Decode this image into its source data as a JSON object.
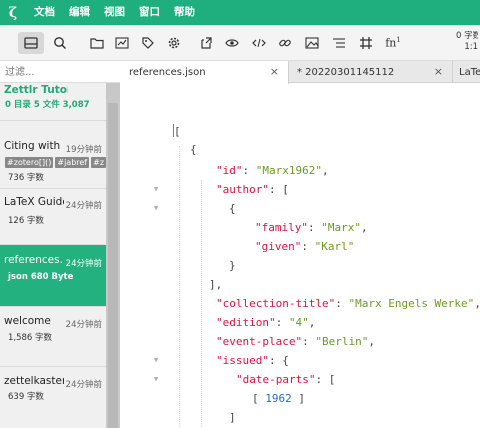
{
  "menubar": {
    "logo_glyph": "ζ",
    "items": [
      "文档",
      "编辑",
      "视图",
      "窗口",
      "帮助"
    ]
  },
  "toolbar": {
    "stats_line1": "0 字数",
    "stats_line2": "1:1"
  },
  "sidebar": {
    "filter_placeholder": "过滤...",
    "files": [
      {
        "title": "Zettlr Tutorial",
        "time": "",
        "meta": "0 目录   5 文件   3,087"
      },
      {
        "title": "Citing with Zettlr",
        "time": "19分钟前",
        "tags": [
          "#zotero[]()",
          "#jabref",
          "#z"
        ],
        "meta": "736 字数"
      },
      {
        "title": "LaTeX Guide",
        "time": "24分钟前",
        "meta": "126 字数"
      },
      {
        "title": "references.json",
        "time": "24分钟前",
        "meta": "json    680 Byte"
      },
      {
        "title": "welcome",
        "time": "24分钟前",
        "meta": "1,586 字数"
      },
      {
        "title": "zettelkasten",
        "time": "24分钟前",
        "meta": "639 字数"
      }
    ]
  },
  "tabs": [
    {
      "label": "references.json",
      "close": "×"
    },
    {
      "label": "* 20220301145112",
      "close": "×"
    },
    {
      "label": "LaTeX",
      "close": ""
    }
  ],
  "code": {
    "l1": "[",
    "l2": "{",
    "id_key": "\"id\"",
    "id_val": "\"Marx1962\"",
    "author_key": "\"author\"",
    "family_key": "\"family\"",
    "family_val": "\"Marx\"",
    "given_key": "\"given\"",
    "given_val": "\"Karl\"",
    "collection_key": "\"collection-title\"",
    "collection_val": "\"Marx Engels Werke\"",
    "edition_key": "\"edition\"",
    "edition_val": "\"4\"",
    "place_key": "\"event-place\"",
    "place_val": "\"Berlin\"",
    "issued_key": "\"issued\"",
    "dateparts_key": "\"date-parts\"",
    "year_val": "1962"
  },
  "colors": {
    "accent": "#1fae7e",
    "key": "#dd1144",
    "string": "#6a9a1f",
    "number": "#1a6ad6"
  }
}
